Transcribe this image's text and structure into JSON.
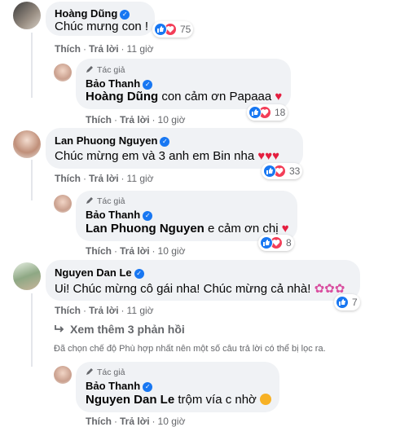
{
  "comments": [
    {
      "name": "Hoàng Dũng",
      "text": "Chúc mưng con !",
      "count": "75",
      "like": "Thích",
      "reply": "Trả lời",
      "time": "11 giờ"
    },
    {
      "tag": "Tác giả",
      "name": "Bảo Thanh",
      "mention": "Hoàng Dũng",
      "text": " con cảm ơn Papaaa ",
      "count": "18",
      "like": "Thích",
      "reply": "Trả lời",
      "time": "10 giờ"
    },
    {
      "name": "Lan Phuong Nguyen",
      "text": "Chúc mừng em và 3 anh em Bin nha ",
      "count": "33",
      "like": "Thích",
      "reply": "Trả lời",
      "time": "11 giờ"
    },
    {
      "tag": "Tác giả",
      "name": "Bảo Thanh",
      "mention": "Lan Phuong Nguyen",
      "text": " e cảm ơn chị ",
      "count": "8",
      "like": "Thích",
      "reply": "Trả lời",
      "time": "10 giờ"
    },
    {
      "name": "Nguyen Dan Le",
      "text": "Ui! Chúc mừng cô gái nha! Chúc mừng cả nhà! ",
      "count": "7",
      "like": "Thích",
      "reply": "Trả lời",
      "time": "11 giờ"
    },
    {
      "tag": "Tác giả",
      "name": "Bảo Thanh",
      "mention": "Nguyen Dan Le",
      "text": " trộm vía c nhờ ",
      "like": "Thích",
      "reply": "Trả lời",
      "time": "10 giờ"
    }
  ],
  "more_replies": "Xem thêm 3 phản hồi",
  "filter_notice": "Đã chọn chế độ Phù hợp nhất nên một số câu trả lời có thể bị lọc ra.",
  "colors": {
    "accent": "#1877f2",
    "bubble": "#f0f2f5",
    "love": "#f33e58",
    "muted": "#65676b"
  }
}
